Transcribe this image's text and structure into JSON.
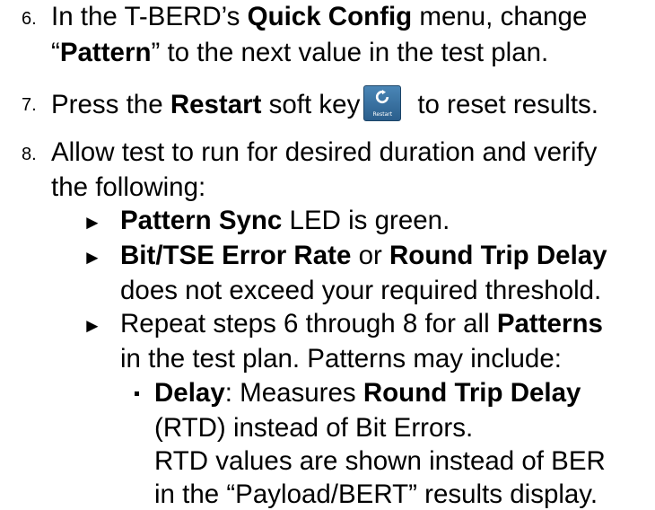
{
  "steps": {
    "s6": {
      "num": "6.",
      "l1_a": "In the T-BERD’s ",
      "l1_b": "Quick Config",
      "l1_c": " menu, change",
      "l2_a": "“",
      "l2_b": "Pattern",
      "l2_c": "” to the next value in the test plan."
    },
    "s7": {
      "num": "7.",
      "a": "Press the ",
      "b": "Restart",
      "c": " soft key",
      "icon_label": "Restart",
      "d": "to reset results."
    },
    "s8": {
      "num": "8.",
      "l1": "Allow test to run for desired duration and verify",
      "l2": "the following:"
    }
  },
  "bullets": {
    "marker": "►",
    "b1": {
      "a": "Pattern Sync",
      "b": " LED is green."
    },
    "b2": {
      "a": "Bit/TSE Error Rate",
      "b": " or ",
      "c": "Round Trip Delay",
      "l2": "does not exceed your required threshold."
    },
    "b3": {
      "a": "Repeat steps 6 through 8 for all ",
      "b": "Patterns",
      "l2": "in the test plan.  Patterns may include:"
    }
  },
  "sub": {
    "d1": {
      "a": "Delay",
      "b": ": Measures ",
      "c": "Round Trip Delay",
      "l2": "(RTD) instead of Bit Errors.",
      "l3": "RTD values are shown instead of BER",
      "l4": "in the “Payload/BERT” results display."
    }
  },
  "colors": {
    "icon_bg": "#3a74a4",
    "text": "#000000"
  },
  "icons": {
    "restart": "restart-icon"
  }
}
